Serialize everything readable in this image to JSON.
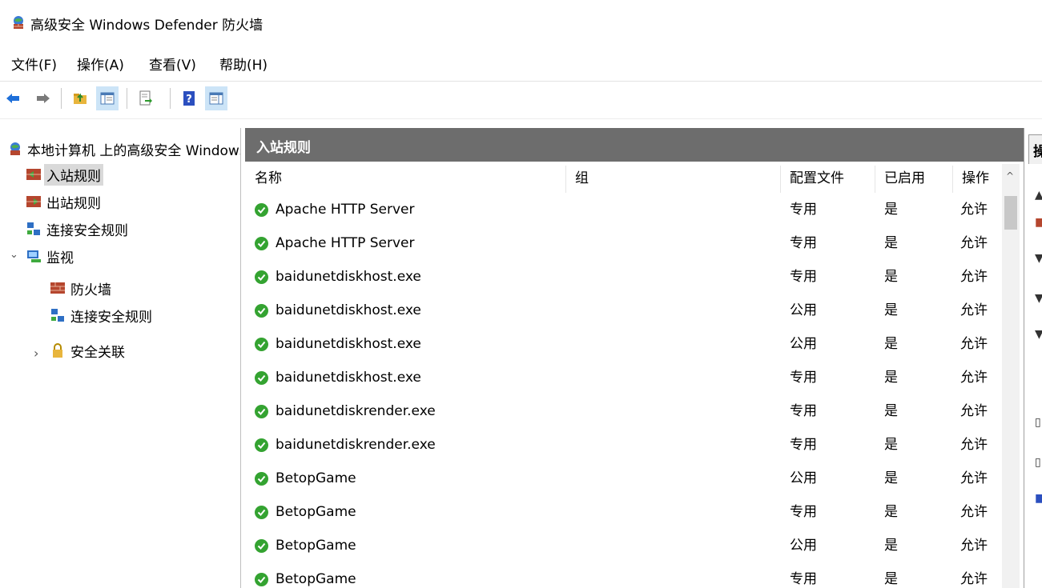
{
  "window": {
    "title": "高级安全 Windows Defender 防火墙"
  },
  "menu": [
    {
      "label": "文件(F)"
    },
    {
      "label": "操作(A)"
    },
    {
      "label": "查看(V)"
    },
    {
      "label": "帮助(H)"
    }
  ],
  "toolbar": {
    "buttons": [
      "back-icon",
      "forward-icon",
      "up-folder-icon",
      "show-hide-tree-icon",
      "export-list-icon",
      "help-icon",
      "show-hide-action-pane-icon"
    ]
  },
  "tree": {
    "root_label": "本地计算机 上的高级安全 Windows Defender 防火墙",
    "items": [
      {
        "label": "入站规则"
      },
      {
        "label": "出站规则"
      },
      {
        "label": "连接安全规则"
      },
      {
        "label": "监视"
      },
      {
        "label": "防火墙"
      },
      {
        "label": "连接安全规则"
      },
      {
        "label": "安全关联"
      }
    ]
  },
  "pane": {
    "title": "入站规则",
    "columns": [
      "名称",
      "组",
      "配置文件",
      "已启用",
      "操作"
    ],
    "rows": [
      {
        "name": "Apache HTTP Server",
        "group": "",
        "profile": "专用",
        "enabled": "是",
        "action": "允许"
      },
      {
        "name": "Apache HTTP Server",
        "group": "",
        "profile": "专用",
        "enabled": "是",
        "action": "允许"
      },
      {
        "name": "baidunetdiskhost.exe",
        "group": "",
        "profile": "专用",
        "enabled": "是",
        "action": "允许"
      },
      {
        "name": "baidunetdiskhost.exe",
        "group": "",
        "profile": "公用",
        "enabled": "是",
        "action": "允许"
      },
      {
        "name": "baidunetdiskhost.exe",
        "group": "",
        "profile": "公用",
        "enabled": "是",
        "action": "允许"
      },
      {
        "name": "baidunetdiskhost.exe",
        "group": "",
        "profile": "专用",
        "enabled": "是",
        "action": "允许"
      },
      {
        "name": "baidunetdiskrender.exe",
        "group": "",
        "profile": "专用",
        "enabled": "是",
        "action": "允许"
      },
      {
        "name": "baidunetdiskrender.exe",
        "group": "",
        "profile": "专用",
        "enabled": "是",
        "action": "允许"
      },
      {
        "name": "BetopGame",
        "group": "",
        "profile": "公用",
        "enabled": "是",
        "action": "允许"
      },
      {
        "name": "BetopGame",
        "group": "",
        "profile": "专用",
        "enabled": "是",
        "action": "允许"
      },
      {
        "name": "BetopGame",
        "group": "",
        "profile": "公用",
        "enabled": "是",
        "action": "允许"
      },
      {
        "name": "BetopGame",
        "group": "",
        "profile": "专用",
        "enabled": "是",
        "action": "允许"
      }
    ]
  },
  "actions_pane": {
    "title": "操作"
  },
  "colors": {
    "header_bg": "#6d6d6d",
    "check_green": "#34a331",
    "selected_bg": "#d9d9d9",
    "toolbar_pressed": "#cce4f7"
  }
}
